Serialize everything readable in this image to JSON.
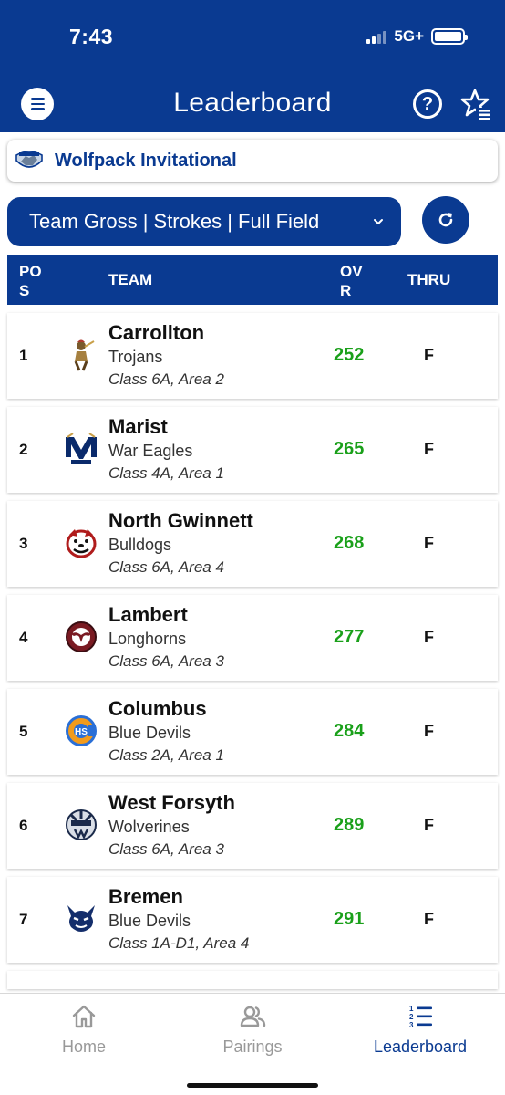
{
  "status_bar": {
    "time": "7:43",
    "network": "5G+"
  },
  "header": {
    "title": "Leaderboard"
  },
  "event": {
    "name": "Wolfpack Invitational"
  },
  "filter": {
    "label": "Team Gross | Strokes | Full Field"
  },
  "table": {
    "headers": {
      "pos": "POS",
      "team": "TEAM",
      "ovr": "OVR",
      "thru": "THRU"
    },
    "rows": [
      {
        "pos": "1",
        "name": "Carrollton",
        "mascot": "Trojans",
        "class": "Class 6A, Area 2",
        "score": "252",
        "thru": "F"
      },
      {
        "pos": "2",
        "name": "Marist",
        "mascot": "War Eagles",
        "class": "Class 4A, Area 1",
        "score": "265",
        "thru": "F"
      },
      {
        "pos": "3",
        "name": "North Gwinnett",
        "mascot": "Bulldogs",
        "class": "Class 6A, Area 4",
        "score": "268",
        "thru": "F"
      },
      {
        "pos": "4",
        "name": "Lambert",
        "mascot": "Longhorns",
        "class": "Class 6A, Area 3",
        "score": "277",
        "thru": "F"
      },
      {
        "pos": "5",
        "name": "Columbus",
        "mascot": "Blue Devils",
        "class": "Class 2A, Area 1",
        "score": "284",
        "thru": "F"
      },
      {
        "pos": "6",
        "name": "West Forsyth",
        "mascot": "Wolverines",
        "class": "Class 6A, Area 3",
        "score": "289",
        "thru": "F"
      },
      {
        "pos": "7",
        "name": "Bremen",
        "mascot": "Blue Devils",
        "class": "Class 1A-D1, Area 4",
        "score": "291",
        "thru": "F"
      }
    ]
  },
  "bottom_nav": {
    "home": "Home",
    "pairings": "Pairings",
    "leaderboard": "Leaderboard",
    "active": "leaderboard"
  },
  "colors": {
    "primary": "#0a3a91",
    "score": "#1aa01a",
    "inactive": "#999999"
  }
}
